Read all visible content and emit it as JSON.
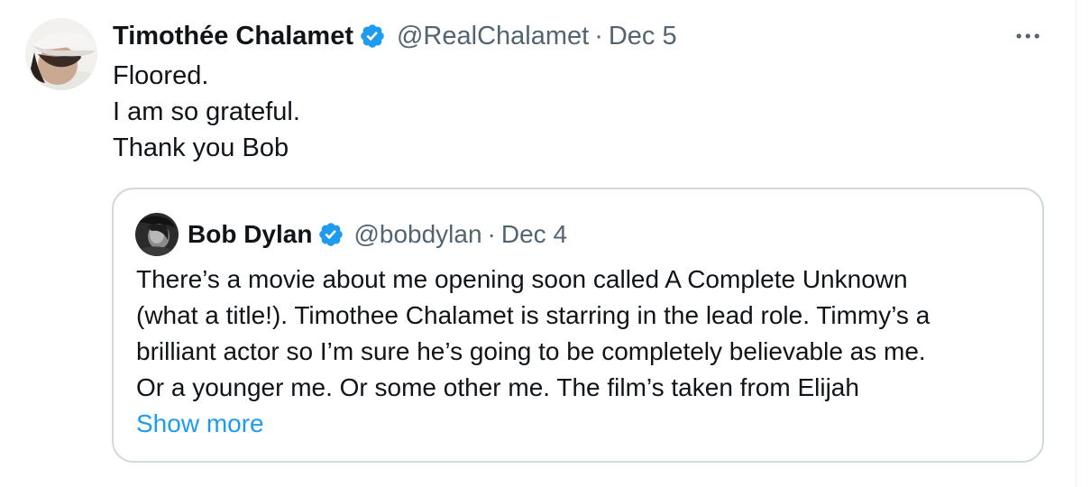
{
  "tweet": {
    "author_name": "Timothée Chalamet",
    "handle": "@RealChalamet",
    "separator": "·",
    "date": "Dec 5",
    "text_lines": [
      "Floored.",
      "I am so grateful.",
      "Thank you Bob"
    ],
    "more_icon": "ellipsis-icon",
    "verified_icon": "verified-badge-icon"
  },
  "quoted_tweet": {
    "author_name": "Bob Dylan",
    "handle": "@bobdylan",
    "separator": "·",
    "date": "Dec 4",
    "text_lines": [
      "There’s a movie about me opening soon called A Complete Unknown",
      "(what a title!). Timothee Chalamet is starring in the lead role. Timmy’s a",
      "brilliant actor so I’m sure he’s going to be completely believable as me.",
      "Or a younger me. Or some other me. The film’s taken from Elijah"
    ],
    "show_more_label": "Show more",
    "verified_icon": "verified-badge-icon"
  },
  "colors": {
    "text_primary": "#0f1419",
    "text_secondary": "#536471",
    "link_blue": "#1d9bf0",
    "verified_blue": "#1d9bf0",
    "border": "#cfd9de"
  }
}
